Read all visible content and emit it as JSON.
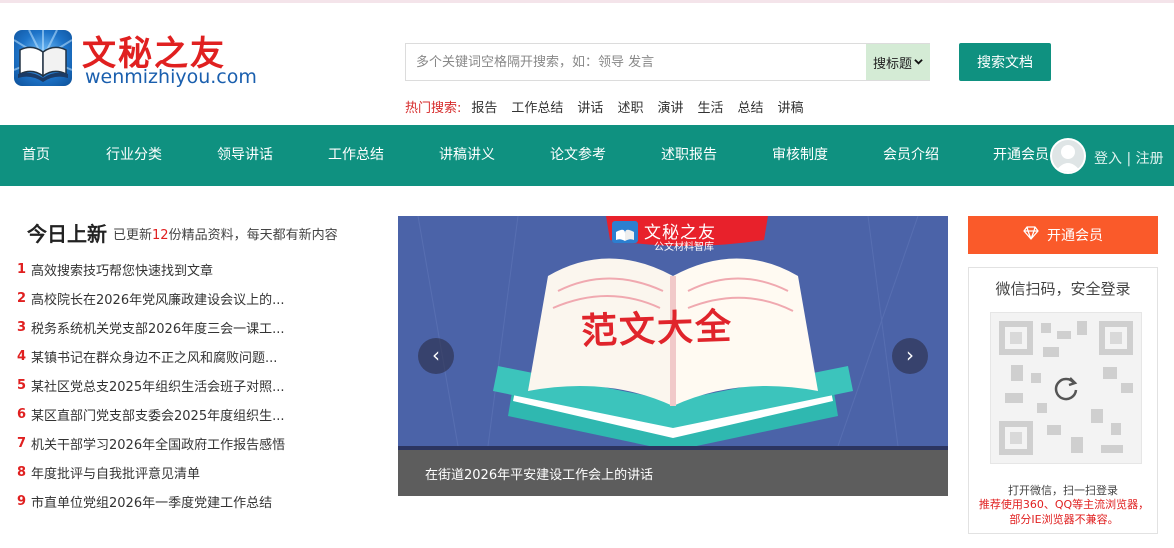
{
  "site": {
    "logo_cn": "文秘之友",
    "logo_en": "wenmizhiyou.com"
  },
  "search": {
    "placeholder": "多个关键词空格隔开搜索，如：领导 发言",
    "select_value": "搜标题",
    "button_label": "搜索文档"
  },
  "hot": {
    "label": "热门搜索:",
    "items": [
      "报告",
      "工作总结",
      "讲话",
      "述职",
      "演讲",
      "生活",
      "总结",
      "讲稿"
    ]
  },
  "nav": {
    "items": [
      "首页",
      "行业分类",
      "领导讲话",
      "工作总结",
      "讲稿讲义",
      "论文参考",
      "述职报告",
      "审核制度",
      "会员介绍",
      "开通会员"
    ],
    "login": "登入",
    "separator": "|",
    "register": "注册"
  },
  "today": {
    "title": "今日上新",
    "sub_prefix": "已更新",
    "sub_count": "12",
    "sub_suffix": "份精品资料，每天都有新内容",
    "items": [
      {
        "num": "1",
        "text": "高效搜索技巧帮您快速找到文章"
      },
      {
        "num": "2",
        "text": "高校院长在2026年党风廉政建设会议上的..."
      },
      {
        "num": "3",
        "text": "税务系统机关党支部2026年度三会一课工..."
      },
      {
        "num": "4",
        "text": "某镇书记在群众身边不正之风和腐败问题..."
      },
      {
        "num": "5",
        "text": "某社区党总支2025年组织生活会班子对照..."
      },
      {
        "num": "6",
        "text": "某区直部门党支部支委会2025年度组织生..."
      },
      {
        "num": "7",
        "text": "机关干部学习2026年全国政府工作报告感悟"
      },
      {
        "num": "8",
        "text": "年度批评与自我批评意见清单"
      },
      {
        "num": "9",
        "text": "市直单位党组2026年一季度党建工作总结"
      }
    ]
  },
  "banner": {
    "tag_title": "文秘之友",
    "tag_sub": "公文材料智库",
    "big_title": "范文大全",
    "caption": "在街道2026年平安建设工作会上的讲话",
    "prev": "‹",
    "next": "›"
  },
  "side": {
    "vip_label": "开通会员",
    "qr_title": "微信扫码，安全登录",
    "qr_tip": "打开微信，扫一扫登录",
    "qr_warn": "推荐使用360、QQ等主流浏览器，部分IE浏览器不兼容。"
  },
  "colors": {
    "brand_green": "#0f9180",
    "accent_red": "#e02020",
    "vip_orange": "#fa5a2a"
  }
}
